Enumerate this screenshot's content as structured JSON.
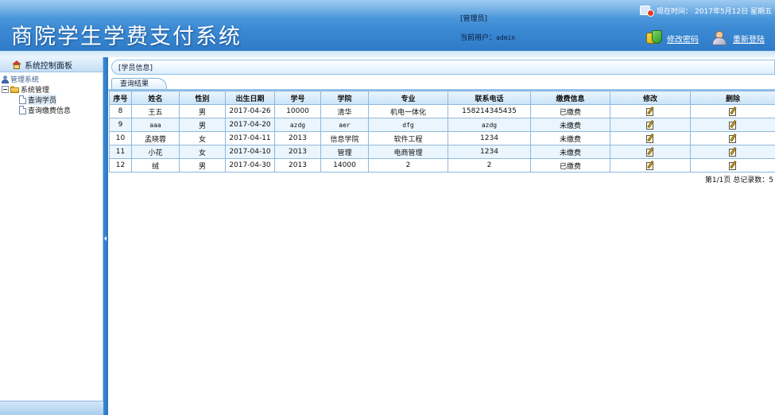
{
  "header": {
    "title": "商院学生学费支付系统",
    "role": "[管理员]",
    "current_user_label": "当前用户：",
    "current_user": "admin",
    "time_label": "现在时间：",
    "date": "2017年5月12日 星期五",
    "change_password": "修改密码",
    "relogin": "重新登陆"
  },
  "sidebar": {
    "panel_title": "系统控制面板",
    "tree": {
      "root": "管理系统",
      "group": "系统管理",
      "items": [
        "查询学员",
        "查询缴费信息"
      ]
    }
  },
  "main": {
    "info_title": "[学员信息]",
    "tab": "查询结果",
    "table": {
      "headers": [
        "序号",
        "姓名",
        "性别",
        "出生日期",
        "学号",
        "学院",
        "专业",
        "联系电话",
        "缴费信息",
        "修改",
        "删除"
      ],
      "rows": [
        [
          "8",
          "王五",
          "男",
          "2017-04-26",
          "10000",
          "清华",
          "机电一体化",
          "158214345435",
          "已缴费"
        ],
        [
          "9",
          "aaa",
          "男",
          "2017-04-20",
          "azdg",
          "aer",
          "dfg",
          "azdg",
          "未缴费"
        ],
        [
          "10",
          "孟晓蓉",
          "女",
          "2017-04-11",
          "2013",
          "信息学院",
          "软件工程",
          "1234",
          "未缴费"
        ],
        [
          "11",
          "小花",
          "女",
          "2017-04-10",
          "2013",
          "管理",
          "电商管理",
          "1234",
          "未缴费"
        ],
        [
          "12",
          "绒",
          "男",
          "2017-04-30",
          "2013",
          "14000",
          "2",
          "2",
          "已缴费"
        ]
      ]
    },
    "pager": "第1/1页  总记录数：5"
  }
}
